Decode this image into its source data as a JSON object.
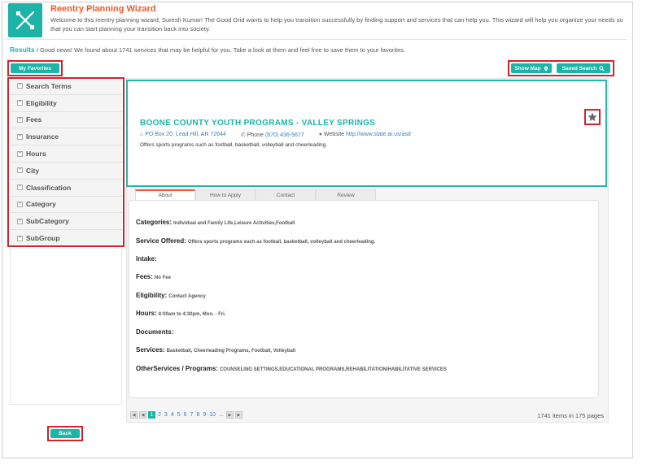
{
  "header": {
    "title": "Reentry Planning Wizard",
    "description": "Welcome to this reentry planning wizard, Suresh Kumar! The Good Grid wants to help you transition successfully by finding support and services that can help you. This wizard will help you organize your needs so that you can start planning your transition back into society."
  },
  "results": {
    "label": "Results",
    "text": "/ Good news! We found about 1741 services that may be helpful for you. Take a look at them and feel free to save them to your favorites."
  },
  "buttons": {
    "favorites": "My Favorites",
    "show_map": "Show Map",
    "saved_search": "Saved Search",
    "back": "Back"
  },
  "filters": [
    "Search Terms",
    "Eligibility",
    "Fees",
    "Insurance",
    "Hours",
    "City",
    "Classification",
    "Category",
    "SubCategory",
    "SubGroup"
  ],
  "program": {
    "name": "BOONE COUNTY YOUTH PROGRAMS - VALLEY SPRINGS",
    "address": "PO Box 20, Lead Hill, AR 72644",
    "phone_label": "Phone",
    "phone": "(870) 436-5677",
    "website_label": "Website",
    "website": "http://www.state.ar.us/asd",
    "description": "Offers sports programs such as football, basketball, volleyball and cheerleading."
  },
  "tabs": [
    "About",
    "How to Apply",
    "Contact",
    "Review"
  ],
  "details": {
    "categories_label": "Categories:",
    "categories": "Individual and Family Life,Leisure Activities,Football",
    "service_label": "Service Offered:",
    "service": "Offers sports programs such as football, basketball, volleyball and cheerleading.",
    "intake_label": "Intake:",
    "fees_label": "Fees:",
    "fees": "No Fee",
    "eligibility_label": "Eligibility:",
    "eligibility": "Contact Agency",
    "hours_label": "Hours:",
    "hours": "8:00am to 4:30pm, Mon. - Fri.",
    "documents_label": "Documents:",
    "services_label": "Services:",
    "services": "Basketball, Cheerleading Programs, Football, Volleyball",
    "other_label": "OtherServices / Programs:",
    "other": "COUNSELING SETTINGS,EDUCATIONAL PROGRAMS,REHABILITATION/HABILITATIVE SERVICES"
  },
  "pager": {
    "current": "1",
    "pages": [
      "2",
      "3",
      "4",
      "5",
      "6",
      "7",
      "8",
      "9",
      "10"
    ],
    "ellipsis": "...",
    "info": "1741 items in 175 pages"
  },
  "colors": {
    "accent": "#1ab5a6",
    "title": "#ef5b2b",
    "highlight": "#d0242b"
  }
}
